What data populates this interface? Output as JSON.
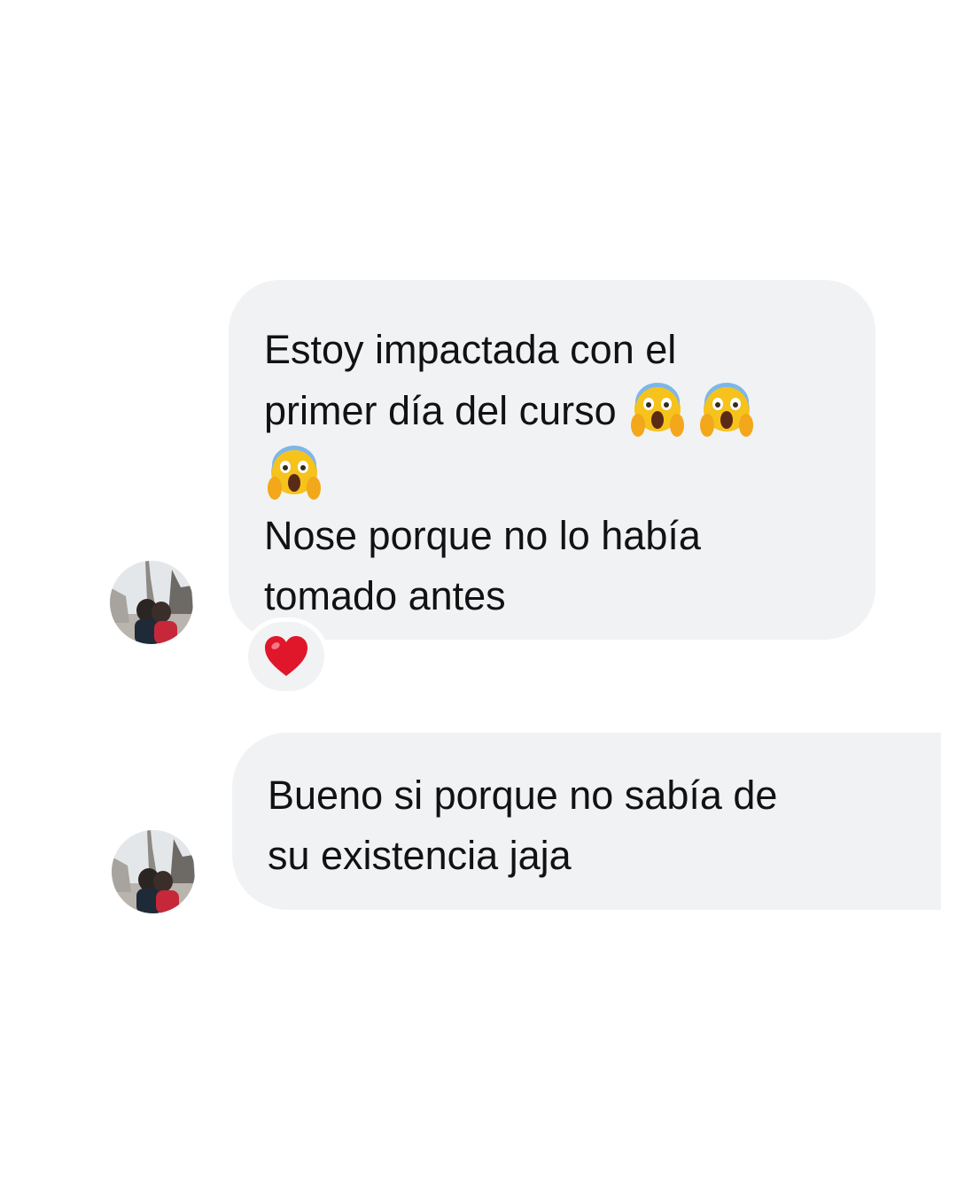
{
  "thread": {
    "messages": [
      {
        "lines": [
          "Estoy impactada con el",
          "primer día del curso",
          "Nose porque no lo había",
          "tomado antes"
        ],
        "emojis": [
          "face-screaming-in-fear-icon",
          "face-screaming-in-fear-icon",
          "face-screaming-in-fear-icon"
        ],
        "reaction": "heart-icon"
      },
      {
        "lines": [
          "Bueno si porque no sabía de",
          "su existencia jaja"
        ]
      }
    ]
  },
  "colors": {
    "background": "#ffffff",
    "bubble": "#f1f2f4",
    "text": "#121212",
    "heart": "#e0162b"
  }
}
